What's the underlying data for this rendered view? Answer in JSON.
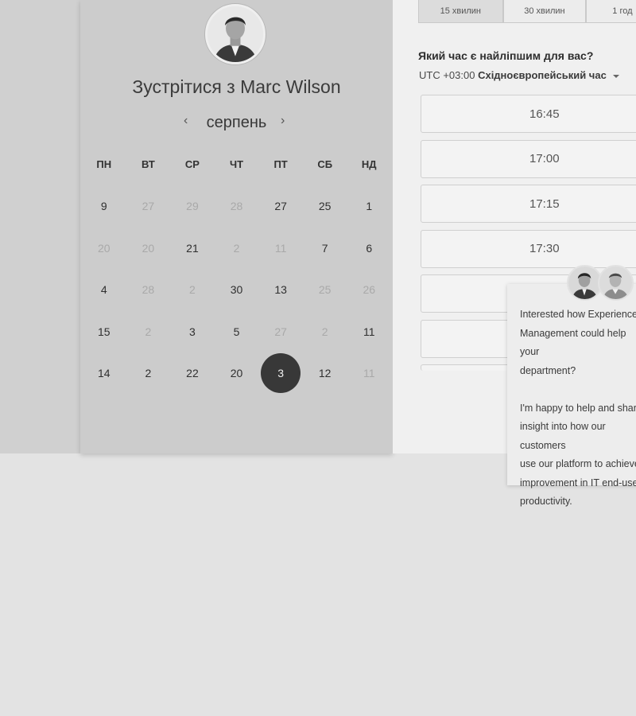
{
  "calendar": {
    "title": "Зустрітися з Marc Wilson",
    "month": "серпень",
    "prev_icon": "chevron-left-icon",
    "next_icon": "chevron-right-icon",
    "weekdays": [
      "ПН",
      "ВТ",
      "СР",
      "ЧТ",
      "ПТ",
      "СБ",
      "НД"
    ],
    "weeks": [
      [
        {
          "label": "9",
          "muted": false
        },
        {
          "label": "27",
          "muted": true
        },
        {
          "label": "29",
          "muted": true
        },
        {
          "label": "28",
          "muted": true
        },
        {
          "label": "27",
          "muted": false
        },
        {
          "label": "25",
          "muted": false
        },
        {
          "label": "1",
          "muted": false
        }
      ],
      [
        {
          "label": "20",
          "muted": true
        },
        {
          "label": "20",
          "muted": true
        },
        {
          "label": "21",
          "muted": false
        },
        {
          "label": "2",
          "muted": true
        },
        {
          "label": "11",
          "muted": true
        },
        {
          "label": "7",
          "muted": false
        },
        {
          "label": "6",
          "muted": false
        }
      ],
      [
        {
          "label": "4",
          "muted": false
        },
        {
          "label": "28",
          "muted": true
        },
        {
          "label": "2",
          "muted": true
        },
        {
          "label": "30",
          "muted": false
        },
        {
          "label": "13",
          "muted": false
        },
        {
          "label": "25",
          "muted": true
        },
        {
          "label": "26",
          "muted": true
        }
      ],
      [
        {
          "label": "15",
          "muted": false
        },
        {
          "label": "2",
          "muted": true
        },
        {
          "label": "3",
          "muted": false
        },
        {
          "label": "5",
          "muted": false
        },
        {
          "label": "27",
          "muted": true
        },
        {
          "label": "2",
          "muted": true
        },
        {
          "label": "11",
          "muted": false
        }
      ],
      [
        {
          "label": "14",
          "muted": false
        },
        {
          "label": "2",
          "muted": false
        },
        {
          "label": "22",
          "muted": false
        },
        {
          "label": "20",
          "muted": false
        },
        {
          "label": "3",
          "muted": false,
          "selected": true
        },
        {
          "label": "12",
          "muted": false
        },
        {
          "label": "11",
          "muted": true
        }
      ]
    ]
  },
  "durations": [
    "15 хвилин",
    "30 хвилин",
    "1 год"
  ],
  "time_picker": {
    "question": "Який час є найліпшим для вас?",
    "tz_offset": "UTC +03:00",
    "tz_name": "Східноєвропейський час",
    "slots": [
      "16:45",
      "17:00",
      "17:15",
      "17:30",
      "",
      "",
      ""
    ]
  },
  "chat": {
    "message": "Interested how Experience\nManagement could help your\ndepartment?\n\nI'm happy to help and share\ninsight into how our customers\nuse our platform to achieve\nimprovement in IT end-user\nproductivity."
  },
  "colors": {
    "selected_day": "#383838",
    "panel_bg": "#cccccc"
  }
}
